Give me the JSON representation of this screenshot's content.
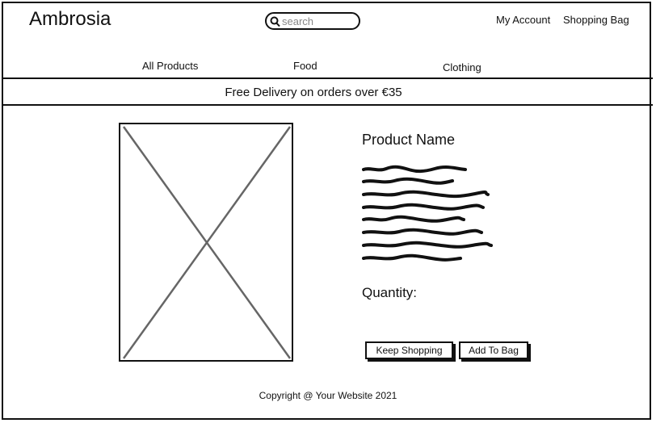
{
  "header": {
    "brand": "Ambrosia",
    "search": {
      "placeholder": "search",
      "value": ""
    },
    "account_label": "My Account",
    "bag_label": "Shopping Bag"
  },
  "nav": {
    "items": [
      {
        "label": "All Products"
      },
      {
        "label": "Food"
      },
      {
        "label": "Clothing"
      }
    ]
  },
  "banner": {
    "text": "Free Delivery on orders over €35"
  },
  "product": {
    "name": "Product Name",
    "image_icon": "image-placeholder-icon",
    "quantity_label": "Quantity:"
  },
  "actions": {
    "keep_shopping_label": "Keep Shopping",
    "add_to_bag_label": "Add To Bag"
  },
  "footer": {
    "copyright": "Copyright @ Your Website 2021"
  }
}
